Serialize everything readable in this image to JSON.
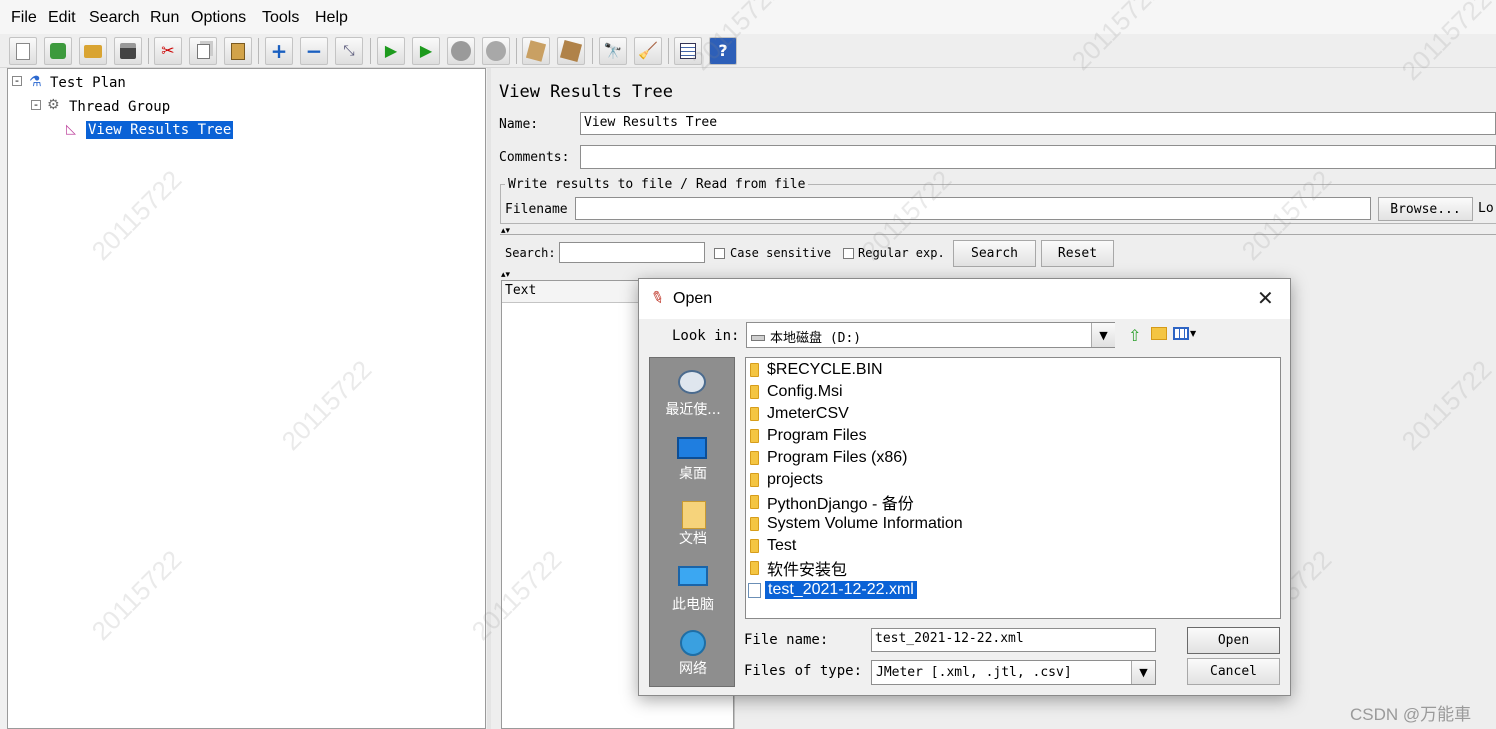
{
  "menu": [
    "File",
    "Edit",
    "Search",
    "Run",
    "Options",
    "Tools",
    "Help"
  ],
  "toolbar_icons": [
    "new-icon",
    "templates-icon",
    "open-icon",
    "save-icon",
    "cut-icon",
    "copy-icon",
    "paste-icon",
    "expand-icon",
    "collapse-icon",
    "toggle-icon",
    "start-icon",
    "start-no-pause-icon",
    "stop-icon",
    "shutdown-icon",
    "clear-icon",
    "clear-all-icon",
    "search-icon",
    "reset-search-icon",
    "function-helper-icon",
    "help-icon"
  ],
  "tree": {
    "test_plan": "Test Plan",
    "thread_group": "Thread Group",
    "view_results_tree": "View Results Tree"
  },
  "panel": {
    "title": "View Results Tree",
    "name_label": "Name:",
    "name_value": "View Results Tree",
    "comments_label": "Comments:",
    "comments_value": "",
    "file_group_label": "Write results to file / Read from file",
    "filename_label": "Filename",
    "filename_value": "",
    "browse_button": "Browse...",
    "log_cut": "Lo",
    "search_label": "Search:",
    "case_sensitive": "Case sensitive",
    "regular_exp": "Regular exp.",
    "search_button": "Search",
    "reset_button": "Reset",
    "text_header": "Text"
  },
  "dialog": {
    "title": "Open",
    "look_in_label": "Look in:",
    "look_in_value": "本地磁盘 (D:)",
    "places": [
      "最近使...",
      "桌面",
      "文档",
      "此电脑",
      "网络"
    ],
    "files": [
      {
        "name": "$RECYCLE.BIN",
        "type": "folder"
      },
      {
        "name": "Config.Msi",
        "type": "folder"
      },
      {
        "name": "JmeterCSV",
        "type": "folder"
      },
      {
        "name": "Program Files",
        "type": "folder"
      },
      {
        "name": "Program Files (x86)",
        "type": "folder"
      },
      {
        "name": "projects",
        "type": "folder"
      },
      {
        "name": "PythonDjango - 备份",
        "type": "folder"
      },
      {
        "name": "System Volume Information",
        "type": "folder"
      },
      {
        "name": "Test",
        "type": "folder"
      },
      {
        "name": "软件安装包",
        "type": "folder"
      },
      {
        "name": "test_2021-12-22.xml",
        "type": "file"
      }
    ],
    "file_name_label": "File name:",
    "file_name_value": "test_2021-12-22.xml",
    "files_of_type_label": "Files of type:",
    "files_of_type_value": "JMeter [.xml, .jtl, .csv]",
    "open_button": "Open",
    "cancel_button": "Cancel"
  },
  "watermark": "20115722",
  "footer_credit": "CSDN @万能車",
  "colors": {
    "selection": "#0a62d6",
    "places_panel": "#8e8e8e",
    "folder": "#f4c542"
  }
}
